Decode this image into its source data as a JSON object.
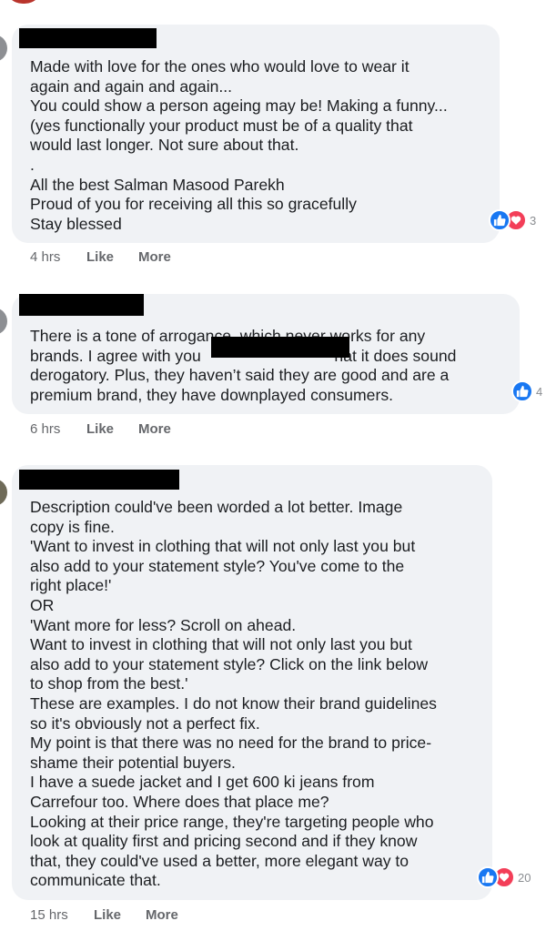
{
  "comments": [
    {
      "text": "Made with love for the ones who would love to wear it\nagain and again and again...\nYou could show a person ageing may be! Making a funny...\n(yes functionally your product must be of a quality that\nwould last longer. Not sure about that.\n.\nAll the best Salman Masood Parekh\nProud of you for receiving all this so gracefully\nStay blessed",
      "reaction_count": "3",
      "time": "4 hrs",
      "like_label": "Like",
      "more_label": "More"
    },
    {
      "text": "There is a tone of arrogance, which never works for any\nbrands. I agree with you                              hat it does sound\nderogatory. Plus, they haven’t said they are good and are a\npremium brand, they have downplayed consumers.",
      "reaction_count": "4",
      "time": "6 hrs",
      "like_label": "Like",
      "more_label": "More"
    },
    {
      "text": "Description could've been worded a lot better. Image\ncopy is fine.\n'Want to invest in clothing that will not only last you but\nalso add to your statement style? You've come to the\nright place!'\nOR\n'Want more for less? Scroll on ahead.\nWant to invest in clothing that will not only last you but\nalso add to your statement style? Click on the link below\nto shop from the best.'\nThese are examples. I do not know their brand guidelines\nso it's obviously not a perfect fix.\nMy point is that there was no need for the brand to price-\nshame their potential buyers.\nI have a suede jacket and I get 600 ki jeans from\nCarrefour too. Where does that place me?\nLooking at their price range, they're targeting people who\nlook at quality first and pricing second and if they know\nthat, they could've used a better, more elegant way to\ncommunicate that.",
      "reaction_count": "20",
      "time": "15 hrs",
      "like_label": "Like",
      "more_label": "More"
    }
  ],
  "colors": {
    "bubble": "#f0f2f5",
    "like_blue": "#1877f2",
    "love_red": "#f33e58",
    "action_gray": "#65676b"
  },
  "icons": [
    "like-icon",
    "love-icon"
  ]
}
